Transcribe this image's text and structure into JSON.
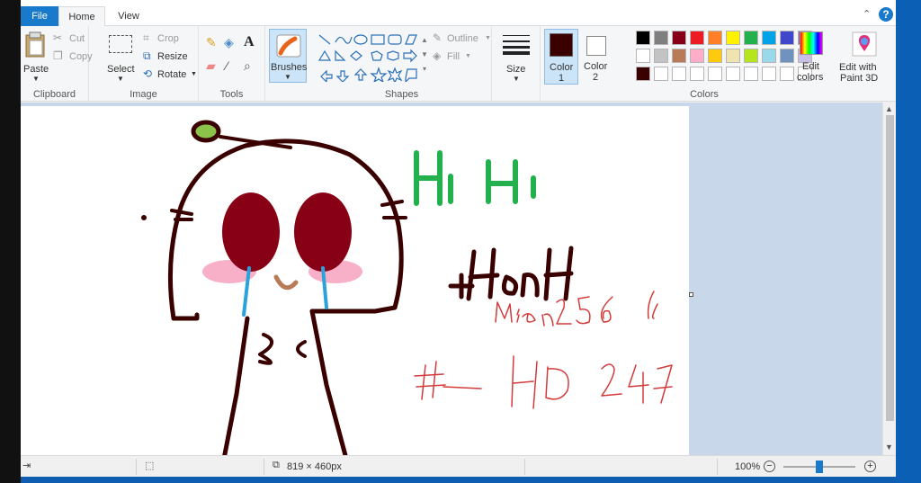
{
  "tabs": {
    "file": "File",
    "home": "Home",
    "view": "View"
  },
  "clipboard": {
    "paste": "Paste",
    "cut": "Cut",
    "copy": "Copy",
    "label": "Clipboard"
  },
  "image": {
    "select": "Select",
    "crop": "Crop",
    "resize": "Resize",
    "rotate": "Rotate",
    "label": "Image"
  },
  "tools": {
    "label": "Tools"
  },
  "brushes": {
    "label": "Brushes"
  },
  "shapes": {
    "outline": "Outline",
    "fill": "Fill",
    "label": "Shapes"
  },
  "size": {
    "label": "Size"
  },
  "color1": {
    "label": "Color",
    "num": "1",
    "value": "#3a0000"
  },
  "color2": {
    "label": "Color",
    "num": "2",
    "value": "#ffffff"
  },
  "colors": {
    "label": "Colors",
    "row1": [
      "#000000",
      "#7f7f7f",
      "#880015",
      "#ed1c24",
      "#ff7f27",
      "#fff200",
      "#22b14c",
      "#00a2e8",
      "#3f48cc",
      "#a349a4"
    ],
    "row2": [
      "#ffffff",
      "#c3c3c3",
      "#b97a57",
      "#ffaec9",
      "#ffc90e",
      "#efe4b0",
      "#b5e61d",
      "#99d9ea",
      "#7092be",
      "#c8bfe7"
    ],
    "row3": [
      "#3a0000",
      "#ffffff",
      "#ffffff",
      "#ffffff",
      "#ffffff",
      "#ffffff",
      "#ffffff",
      "#ffffff",
      "#ffffff",
      "#ffffff"
    ]
  },
  "edit_colors": {
    "line1": "Edit",
    "line2": "colors"
  },
  "paint3d": {
    "line1": "Edit with",
    "line2": "Paint 3D"
  },
  "drawing": {
    "hihi": "HiHi",
    "name": "+HonH",
    "mien": "Mien256",
    "tag": "# HD247"
  },
  "status": {
    "dimensions": "819 × 460px",
    "zoom": "100%"
  }
}
